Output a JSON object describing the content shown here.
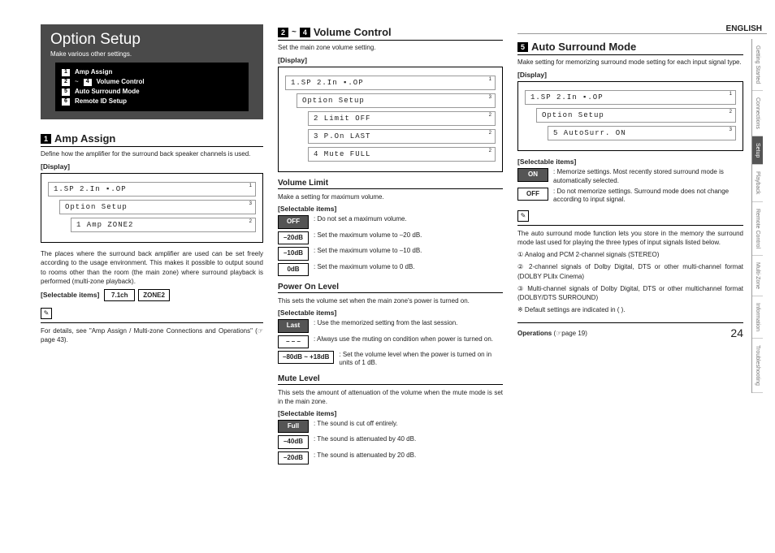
{
  "lang": "ENGLISH",
  "tabs": [
    "Getting Started",
    "Connections",
    "Setup",
    "Playback",
    "Remote Control",
    "Multi-Zone",
    "Information",
    "Troubleshooting"
  ],
  "hdr": {
    "title": "Option Setup",
    "sub": "Make various other settings."
  },
  "toc": {
    "r1n": "1",
    "r1t": "Amp Assign",
    "r2a": "2",
    "r2b": "4",
    "r2t": "Volume Control",
    "r3n": "5",
    "r3t": "Auto Surround Mode",
    "r4n": "6",
    "r4t": "Remote ID Setup"
  },
  "amp": {
    "num": "1",
    "title": "Amp Assign",
    "desc": "Define how the amplifier for the surround back speaker channels is used.",
    "display": "[Display]",
    "lcd1": "1.SP 2.In ▪.OP",
    "lcd2": "Option Setup",
    "lcd3": "1 Amp ZONE2",
    "body": "The places where the surround back amplifier are used can be set freely according to the usage environment. This makes it possible to output sound to rooms other than the room (the main zone) where surround playback is performed (multi-zone playback).",
    "si": "[Selectable items]",
    "c1": "7.1ch",
    "c2": "ZONE2",
    "note": "For details, see \"Amp Assign / Multi-zone Connections and Operations\" (☞page 43)."
  },
  "vol": {
    "na": "2",
    "nb": "4",
    "title": "Volume Control",
    "desc": "Set the main zone volume setting.",
    "display": "[Display]",
    "lcd1": "1.SP 2.In ▪.OP",
    "lcd2": "Option Setup",
    "lcd3": "2 Limit  OFF",
    "lcd4": "3 P.On  LAST",
    "lcd5": "4 Mute  FULL",
    "sub1": "Volume Limit",
    "sub1d": "Make a setting for maximum volume.",
    "si": "[Selectable items]",
    "s1": [
      {
        "c": "OFF",
        "f": 1,
        "t": ": Do not set a maximum volume."
      },
      {
        "c": "–20dB",
        "t": ": Set the maximum volume to –20 dB."
      },
      {
        "c": "–10dB",
        "t": ": Set the maximum volume to –10 dB."
      },
      {
        "c": "0dB",
        "t": ": Set the maximum volume to 0 dB."
      }
    ],
    "sub2": "Power On Level",
    "sub2d": "This sets the volume set when the main zone's power is turned on.",
    "s2": [
      {
        "c": "Last",
        "f": 1,
        "t": ": Use the memorized setting from the last session."
      },
      {
        "c": "– – –",
        "t": ": Always use the muting on condition when power is turned on."
      },
      {
        "c": "–80dB ~ +18dB",
        "t": ": Set the volume level when the power is turned on in units of 1 dB."
      }
    ],
    "sub3": "Mute Level",
    "sub3d": "This sets the amount of attenuation of the volume when the mute mode is set in the main zone.",
    "s3": [
      {
        "c": "Full",
        "f": 1,
        "t": ": The sound is cut off entirely."
      },
      {
        "c": "–40dB",
        "t": ": The sound is attenuated by 40 dB."
      },
      {
        "c": "–20dB",
        "t": ": The sound is attenuated by 20 dB."
      }
    ]
  },
  "auto": {
    "num": "5",
    "title": "Auto Surround Mode",
    "desc": "Make setting for memorizing surround mode setting for each input signal type.",
    "display": "[Display]",
    "lcd1": "1.SP 2.In ▪.OP",
    "lcd2": "Option Setup",
    "lcd3": "5 AutoSurr. ON",
    "si": "[Selectable items]",
    "on": "ON",
    "ont": ": Memorize settings. Most recently stored surround mode is automatically selected.",
    "off": "OFF",
    "offt": ": Do not memorize settings. Surround mode does not change according to input signal.",
    "note": "The auto surround mode function lets you store in the memory the surround mode last used for playing the three types of input signals listed below.",
    "li1": "① Analog and PCM 2-channel signals (STEREO)",
    "li2": "② 2-channel signals of Dolby Digital, DTS or other multi-channel format (DOLBY PLⅡx Cinema)",
    "li3": "③ Multi-channel signals of Dolby Digital, DTS or other multichannel format (DOLBY/DTS SURROUND)",
    "li4": "※ Default settings are indicated in ( )."
  },
  "foot": {
    "ops": "Operations",
    "ref": "(☞page 19)",
    "pn": "24"
  }
}
